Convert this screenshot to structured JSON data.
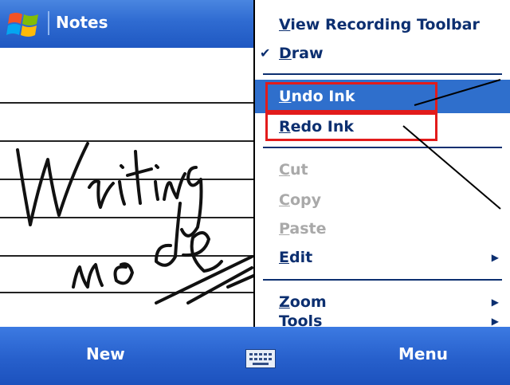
{
  "title": "Notes",
  "notes": {
    "handwriting": "Writing mode"
  },
  "menu": {
    "items": [
      {
        "label": "View Recording Toolbar",
        "underline": "V",
        "checked": false,
        "enabled": true,
        "submenu": false
      },
      {
        "label": "Draw",
        "underline": "D",
        "checked": true,
        "enabled": true,
        "submenu": false
      },
      {
        "label": "Undo Ink",
        "underline": "U",
        "checked": false,
        "enabled": true,
        "submenu": false,
        "highlighted": true
      },
      {
        "label": "Redo Ink",
        "underline": "R",
        "checked": false,
        "enabled": true,
        "submenu": false
      },
      {
        "label": "Cut",
        "underline": "C",
        "checked": false,
        "enabled": false,
        "submenu": false
      },
      {
        "label": "Copy",
        "underline": "C",
        "checked": false,
        "enabled": false,
        "submenu": false
      },
      {
        "label": "Paste",
        "underline": "P",
        "checked": false,
        "enabled": false,
        "submenu": false
      },
      {
        "label": "Edit",
        "underline": "E",
        "checked": false,
        "enabled": true,
        "submenu": true
      },
      {
        "label": "Zoom",
        "underline": "Z",
        "checked": false,
        "enabled": true,
        "submenu": true
      },
      {
        "label": "Tools",
        "underline": "o",
        "checked": false,
        "enabled": true,
        "submenu": true
      }
    ]
  },
  "bottombar": {
    "left": "New",
    "right": "Menu"
  },
  "icons": {
    "windows": "windows-logo-icon",
    "keyboard": "keyboard-icon",
    "check": "checkmark-icon",
    "submenu": "submenu-arrow-icon"
  },
  "colors": {
    "accent": "#2f6fcc",
    "menu_text": "#0c2f70",
    "disabled_text": "#a9a9a9",
    "callout_box": "#e21b1b"
  }
}
